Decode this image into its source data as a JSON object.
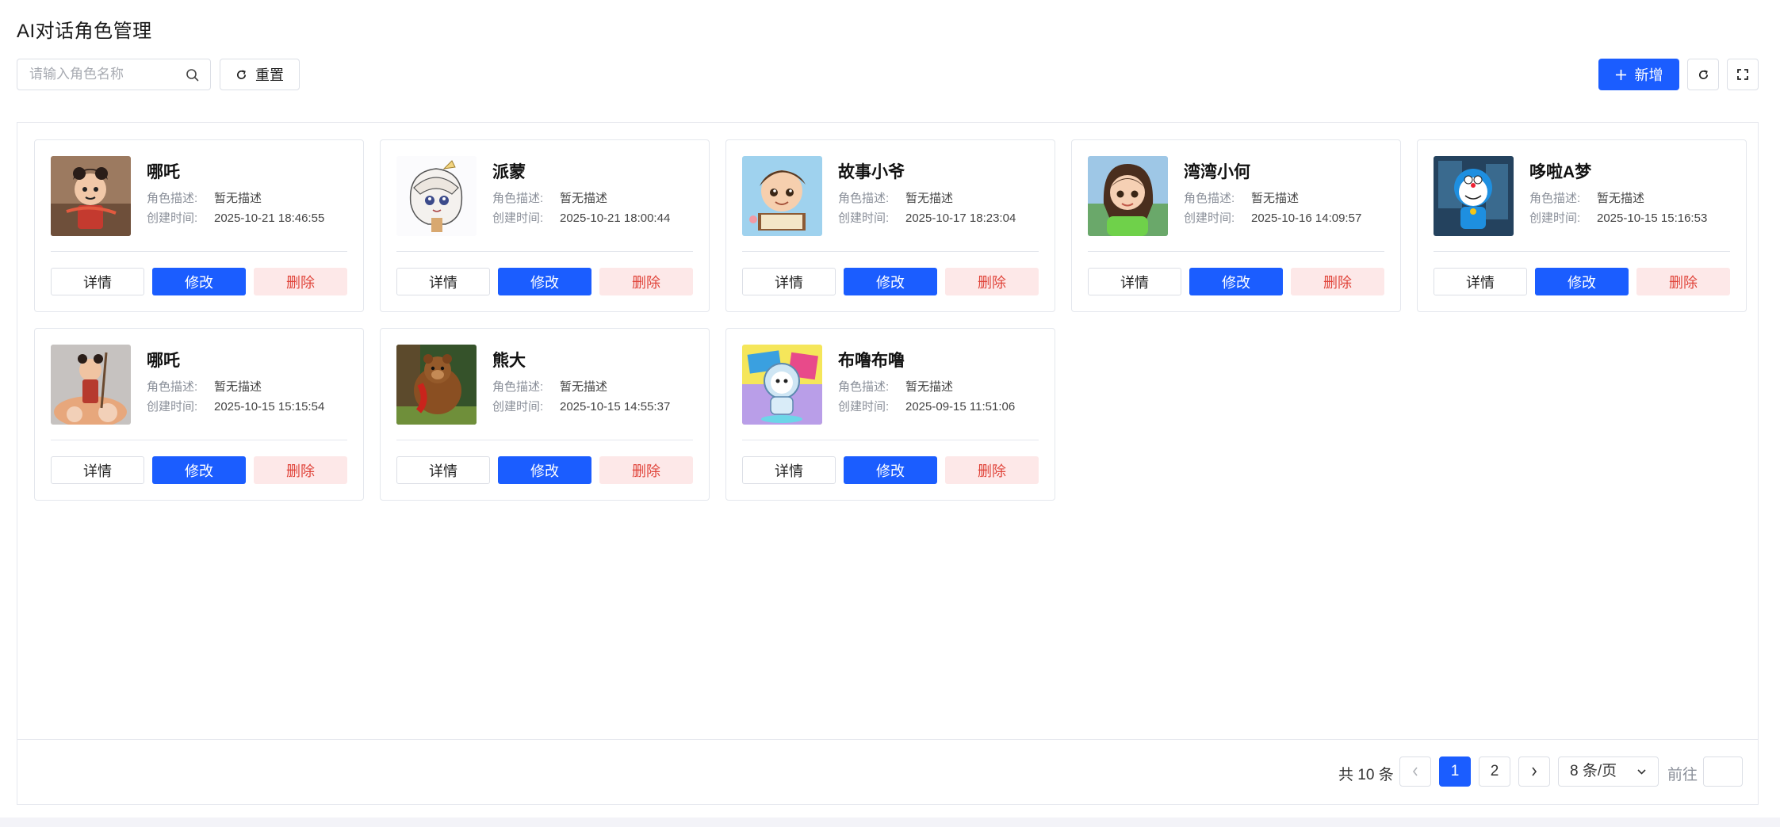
{
  "header": {
    "title": "AI对话角色管理"
  },
  "toolbar": {
    "search_placeholder": "请输入角色名称",
    "search_value": "",
    "reset_label": "重置",
    "add_label": "新增"
  },
  "card_labels": {
    "desc_label": "角色描述:",
    "time_label": "创建时间:",
    "detail": "详情",
    "edit": "修改",
    "delete": "删除"
  },
  "cards": [
    {
      "name": "哪吒",
      "desc": "暂无描述",
      "created": "2025-10-21 18:46:55",
      "avatar": "nezha-avatar"
    },
    {
      "name": "派蒙",
      "desc": "暂无描述",
      "created": "2025-10-21 18:00:44",
      "avatar": "paimon-avatar"
    },
    {
      "name": "故事小爷",
      "desc": "暂无描述",
      "created": "2025-10-17 18:23:04",
      "avatar": "storyteller-avatar"
    },
    {
      "name": "湾湾小何",
      "desc": "暂无描述",
      "created": "2025-10-16 14:09:57",
      "avatar": "girl-avatar"
    },
    {
      "name": "哆啦A梦",
      "desc": "暂无描述",
      "created": "2025-10-15 15:16:53",
      "avatar": "doraemon-avatar"
    },
    {
      "name": "哪吒",
      "desc": "暂无描述",
      "created": "2025-10-15 15:15:54",
      "avatar": "nezha-fire-avatar"
    },
    {
      "name": "熊大",
      "desc": "暂无描述",
      "created": "2025-10-15 14:55:37",
      "avatar": "bear-avatar"
    },
    {
      "name": "布噜布噜",
      "desc": "暂无描述",
      "created": "2025-09-15 11:51:06",
      "avatar": "astronaut-avatar"
    }
  ],
  "pagination": {
    "total_text": "共 10 条",
    "current_page": "1",
    "page_2": "2",
    "page_size": "8 条/页",
    "goto_label": "前往",
    "goto_value": ""
  },
  "colors": {
    "primary": "#1b5dff",
    "danger_text": "#e0443a",
    "danger_bg": "#fde8e8"
  }
}
